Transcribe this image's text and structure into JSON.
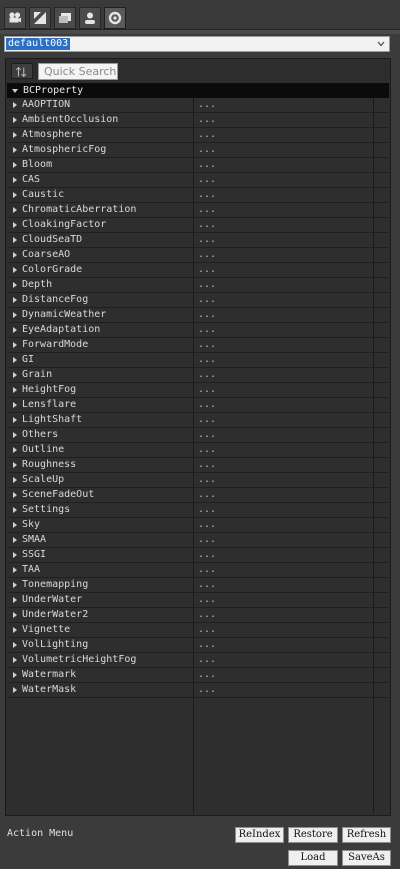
{
  "tabs": [
    {
      "icon": "camera-icon"
    },
    {
      "icon": "lighting-icon"
    },
    {
      "icon": "folder-icon"
    },
    {
      "icon": "person-icon"
    },
    {
      "icon": "gear-icon"
    }
  ],
  "preset": {
    "value": "default003"
  },
  "toolbar": {
    "search_placeholder": "Quick Search"
  },
  "tree": {
    "root_label": "BCProperty",
    "value_text": "...",
    "items": [
      "AAOPTION",
      "AmbientOcclusion",
      "Atmosphere",
      "AtmosphericFog",
      "Bloom",
      "CAS",
      "Caustic",
      "ChromaticAberration",
      "CloakingFactor",
      "CloudSeaTD",
      "CoarseAO",
      "ColorGrade",
      "Depth",
      "DistanceFog",
      "DynamicWeather",
      "EyeAdaptation",
      "ForwardMode",
      "GI",
      "Grain",
      "HeightFog",
      "Lensflare",
      "LightShaft",
      "Others",
      "Outline",
      "Roughness",
      "ScaleUp",
      "SceneFadeOut",
      "Settings",
      "Sky",
      "SMAA",
      "SSGI",
      "TAA",
      "Tonemapping",
      "UnderWater",
      "UnderWater2",
      "Vignette",
      "VolLighting",
      "VolumetricHeightFog",
      "Watermark",
      "WaterMask"
    ]
  },
  "footer": {
    "label": "Action Menu",
    "buttons": {
      "reindex": "ReIndex",
      "restore": "Restore",
      "refresh": "Refresh",
      "load": "Load",
      "saveas": "SaveAs"
    }
  }
}
